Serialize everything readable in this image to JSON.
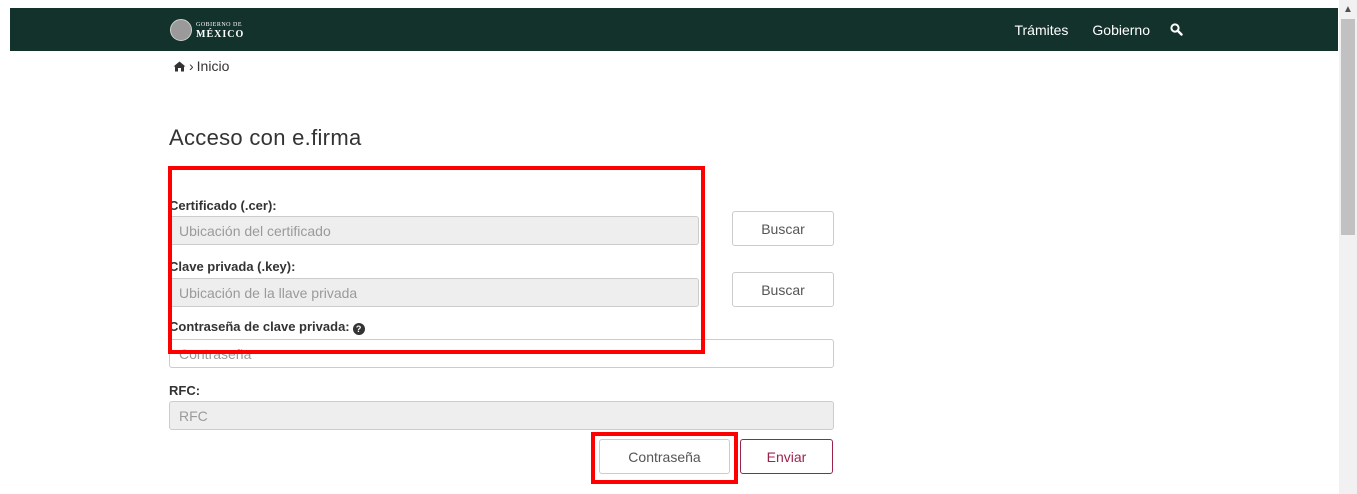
{
  "header": {
    "logo_small": "GOBIERNO DE",
    "logo_big": "MÉXICO",
    "nav": [
      "Trámites",
      "Gobierno"
    ],
    "search_icon": "search-icon",
    "bg_color": "#13322b"
  },
  "breadcrumb": {
    "home_icon": "home-icon",
    "separator": "›",
    "current": "Inicio"
  },
  "form": {
    "title": "Acceso con e.firma",
    "cert_label": "Certificado (.cer):",
    "cert_placeholder": "Ubicación del certificado",
    "key_label": "Clave privada (.key):",
    "key_placeholder": "Ubicación de la llave privada",
    "password_label": "Contraseña de clave privada:",
    "password_placeholder": "Contraseña",
    "rfc_label": "RFC:",
    "rfc_placeholder": "RFC",
    "browse_label": "Buscar",
    "password_button": "Contraseña",
    "submit_button": "Enviar",
    "accent_color": "#9d2449"
  },
  "highlight_color": "#ff0000"
}
